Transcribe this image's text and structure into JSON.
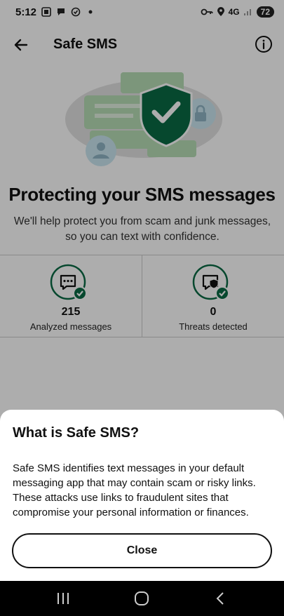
{
  "status_bar": {
    "time": "5:12",
    "network": "4G",
    "battery": "72"
  },
  "header": {
    "title": "Safe SMS"
  },
  "main": {
    "title": "Protecting your SMS messages",
    "description": "We'll help protect you from scam and junk messages, so you can text with confidence."
  },
  "stats": [
    {
      "value": "215",
      "label": "Analyzed messages"
    },
    {
      "value": "0",
      "label": "Threats detected"
    }
  ],
  "sheet": {
    "title": "What is Safe SMS?",
    "body": "Safe SMS identifies text messages in your default messaging app that may contain scam or risky links. These attacks use links to fraudulent sites that compromise your personal information or finances.",
    "close_label": "Close"
  },
  "colors": {
    "accent_green": "#0a6b45",
    "bubble_green": "#b7ddb5",
    "bubble_blue": "#cbe6f0"
  }
}
